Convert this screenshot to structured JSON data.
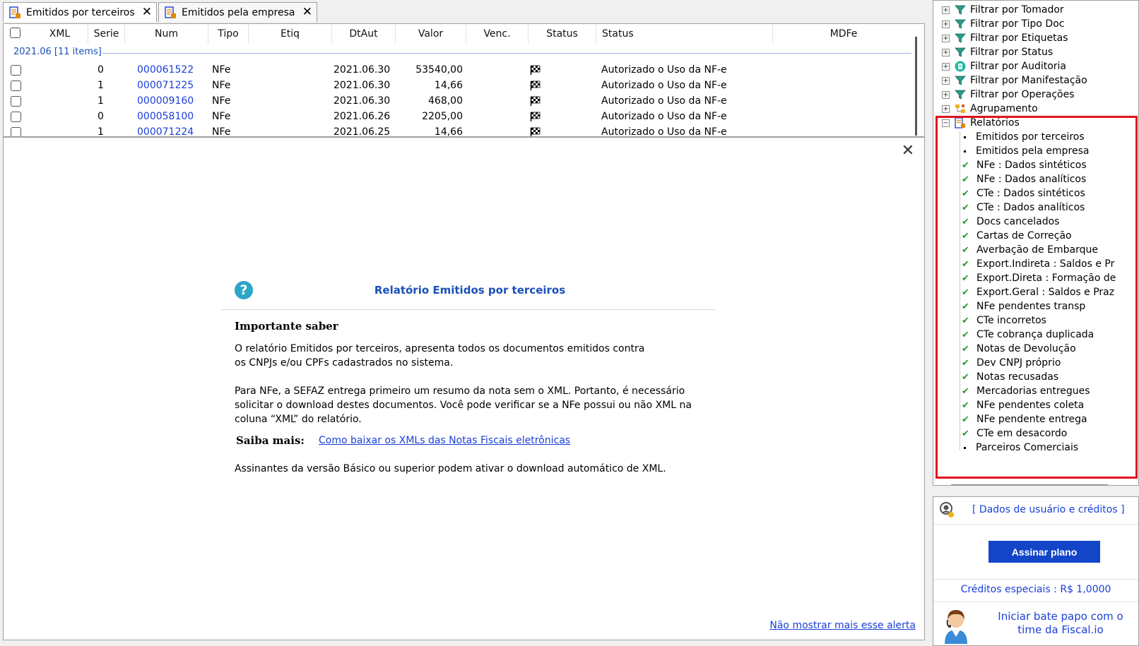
{
  "tabs": [
    {
      "label": "Emitidos por terceiros"
    },
    {
      "label": "Emitidos pela empresa"
    }
  ],
  "grid": {
    "columns": [
      "XML",
      "Serie",
      "Num",
      "Tipo",
      "Etiq",
      "DtAut",
      "Valor",
      "Venc.",
      "Status",
      "Status",
      "MDFe"
    ],
    "group_label": "2021.06 [11 items]",
    "rows": [
      {
        "serie": "0",
        "num": "000061522",
        "tipo": "NFe",
        "dtaut": "2021.06.30",
        "valor": "53540,00",
        "status": "Autorizado o Uso da NF-e"
      },
      {
        "serie": "1",
        "num": "000071225",
        "tipo": "NFe",
        "dtaut": "2021.06.30",
        "valor": "14,66",
        "status": "Autorizado o Uso da NF-e"
      },
      {
        "serie": "1",
        "num": "000009160",
        "tipo": "NFe",
        "dtaut": "2021.06.30",
        "valor": "468,00",
        "status": "Autorizado o Uso da NF-e"
      },
      {
        "serie": "0",
        "num": "000058100",
        "tipo": "NFe",
        "dtaut": "2021.06.26",
        "valor": "2205,00",
        "status": "Autorizado o Uso da NF-e"
      },
      {
        "serie": "1",
        "num": "000071224",
        "tipo": "NFe",
        "dtaut": "2021.06.25",
        "valor": "14,66",
        "status": "Autorizado o Uso da NF-e"
      }
    ]
  },
  "alert": {
    "title": "Relatório Emitidos por terceiros",
    "heading": "Importante saber",
    "paragraph1": "O relatório Emitidos por terceiros, apresenta todos os documentos emitidos contra os CNPJs e/ou CPFs cadastrados no sistema.",
    "paragraph2": "Para NFe, a SEFAZ entrega primeiro um resumo da nota sem o XML. Portanto, é necessário solicitar o download destes documentos. Você pode verificar se a NFe possui ou não XML na coluna “XML” do relatório.",
    "saiba_label": "Saiba mais:",
    "saiba_link": "Como baixar os XMLs das Notas Fiscais eletrônicas",
    "paragraph3": "Assinantes da versão Básico ou superior podem ativar o download automático de XML.",
    "dont_show": "Não mostrar mais esse alerta"
  },
  "tree": {
    "filters": [
      {
        "label": "Filtrar por Tomador",
        "icon": "funnel-icon"
      },
      {
        "label": "Filtrar por Tipo Doc",
        "icon": "funnel-icon"
      },
      {
        "label": "Filtrar por Etiquetas",
        "icon": "funnel-icon"
      },
      {
        "label": "Filtrar por Status",
        "icon": "funnel-icon"
      },
      {
        "label": "Filtrar por Auditoria",
        "icon": "audit-icon"
      },
      {
        "label": "Filtrar por Manifestação",
        "icon": "funnel-icon"
      },
      {
        "label": "Filtrar por Operações",
        "icon": "funnel-icon"
      },
      {
        "label": "Agrupamento",
        "icon": "grouping-icon"
      }
    ],
    "reports_label": "Relatórios",
    "reports": [
      {
        "label": "Emitidos por terceiros",
        "mark": "bullet"
      },
      {
        "label": "Emitidos pela empresa",
        "mark": "bullet"
      },
      {
        "label": "NFe : Dados sintéticos",
        "mark": "check"
      },
      {
        "label": "NFe : Dados analíticos",
        "mark": "check"
      },
      {
        "label": "CTe : Dados sintéticos",
        "mark": "check"
      },
      {
        "label": "CTe : Dados analíticos",
        "mark": "check"
      },
      {
        "label": "Docs cancelados",
        "mark": "check"
      },
      {
        "label": "Cartas de Correção",
        "mark": "check"
      },
      {
        "label": "Averbação de Embarque",
        "mark": "check"
      },
      {
        "label": "Export.Indireta : Saldos e Pr",
        "mark": "check"
      },
      {
        "label": "Export.Direta : Formação de",
        "mark": "check"
      },
      {
        "label": "Export.Geral : Saldos e Praz",
        "mark": "check"
      },
      {
        "label": "NFe pendentes transp",
        "mark": "check"
      },
      {
        "label": "CTe incorretos",
        "mark": "check"
      },
      {
        "label": "CTe cobrança duplicada",
        "mark": "check"
      },
      {
        "label": "Notas de Devolução",
        "mark": "check"
      },
      {
        "label": "Dev CNPJ próprio",
        "mark": "check"
      },
      {
        "label": "Notas recusadas",
        "mark": "check"
      },
      {
        "label": "Mercadorias entregues",
        "mark": "check"
      },
      {
        "label": "NFe pendentes coleta",
        "mark": "check"
      },
      {
        "label": "NFe pendente entrega",
        "mark": "check"
      },
      {
        "label": "CTe em desacordo",
        "mark": "check"
      },
      {
        "label": "Parceiros Comerciais",
        "mark": "bullet"
      }
    ]
  },
  "user_panel": {
    "user_link": "[ Dados de usuário e créditos ]",
    "subscribe_button": "Assinar plano",
    "credits": "Créditos especiais : R$ 1,0000",
    "chat": "Iniciar bate papo com o time da Fiscal.io"
  },
  "colors": {
    "link": "#1a3fd8",
    "highlight_border": "#e0141e",
    "primary_button": "#1245c8",
    "check": "#2c9a2c"
  }
}
